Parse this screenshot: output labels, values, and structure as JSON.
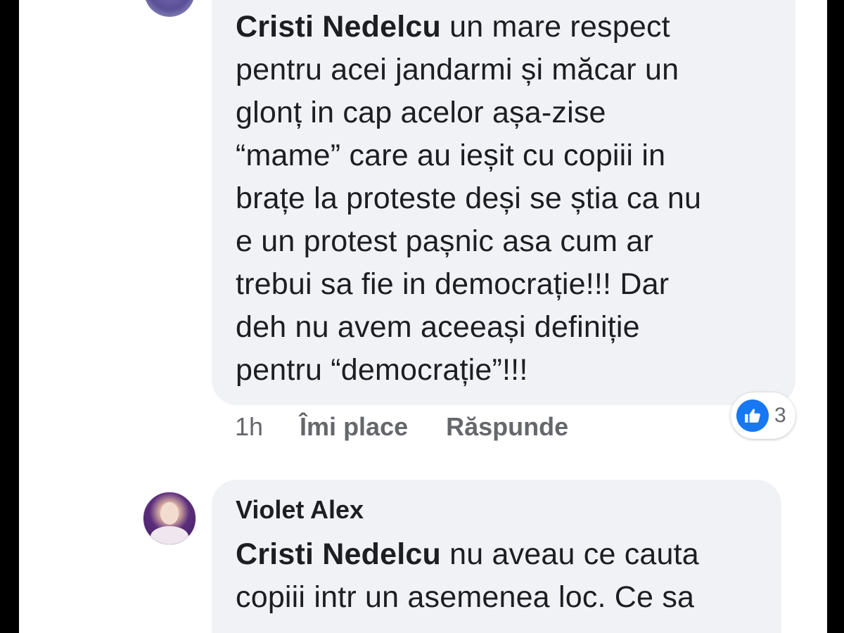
{
  "comment_1": {
    "mention": "Cristi Nedelcu",
    "lines": [
      " un mare respect",
      "pentru acei jandarmi și măcar un",
      "glonț in cap acelor așa-zise",
      "“mame” care au ieșit cu copiii in",
      "brațe la proteste deși se știa ca nu",
      "e un protest pașnic asa cum ar",
      "trebui sa fie in democrație!!! Dar",
      "deh nu avem aceeași definiție",
      "pentru “democrație”!!!"
    ],
    "time": "1h",
    "like_label": "Îmi place",
    "reply_label": "Răspunde",
    "reaction_count": "3",
    "reaction_icon": "thumbs-up-icon",
    "reaction_color": "#1877f2"
  },
  "comment_2": {
    "author": "Violet Alex",
    "mention": "Cristi Nedelcu",
    "lines": [
      " nu aveau ce cauta",
      "copiii intr un asemenea loc. Ce sa"
    ]
  },
  "colors": {
    "bubble": "#f0f2f5",
    "meta_text": "#65676b",
    "text": "#1c1e21",
    "frame": "#000000"
  }
}
